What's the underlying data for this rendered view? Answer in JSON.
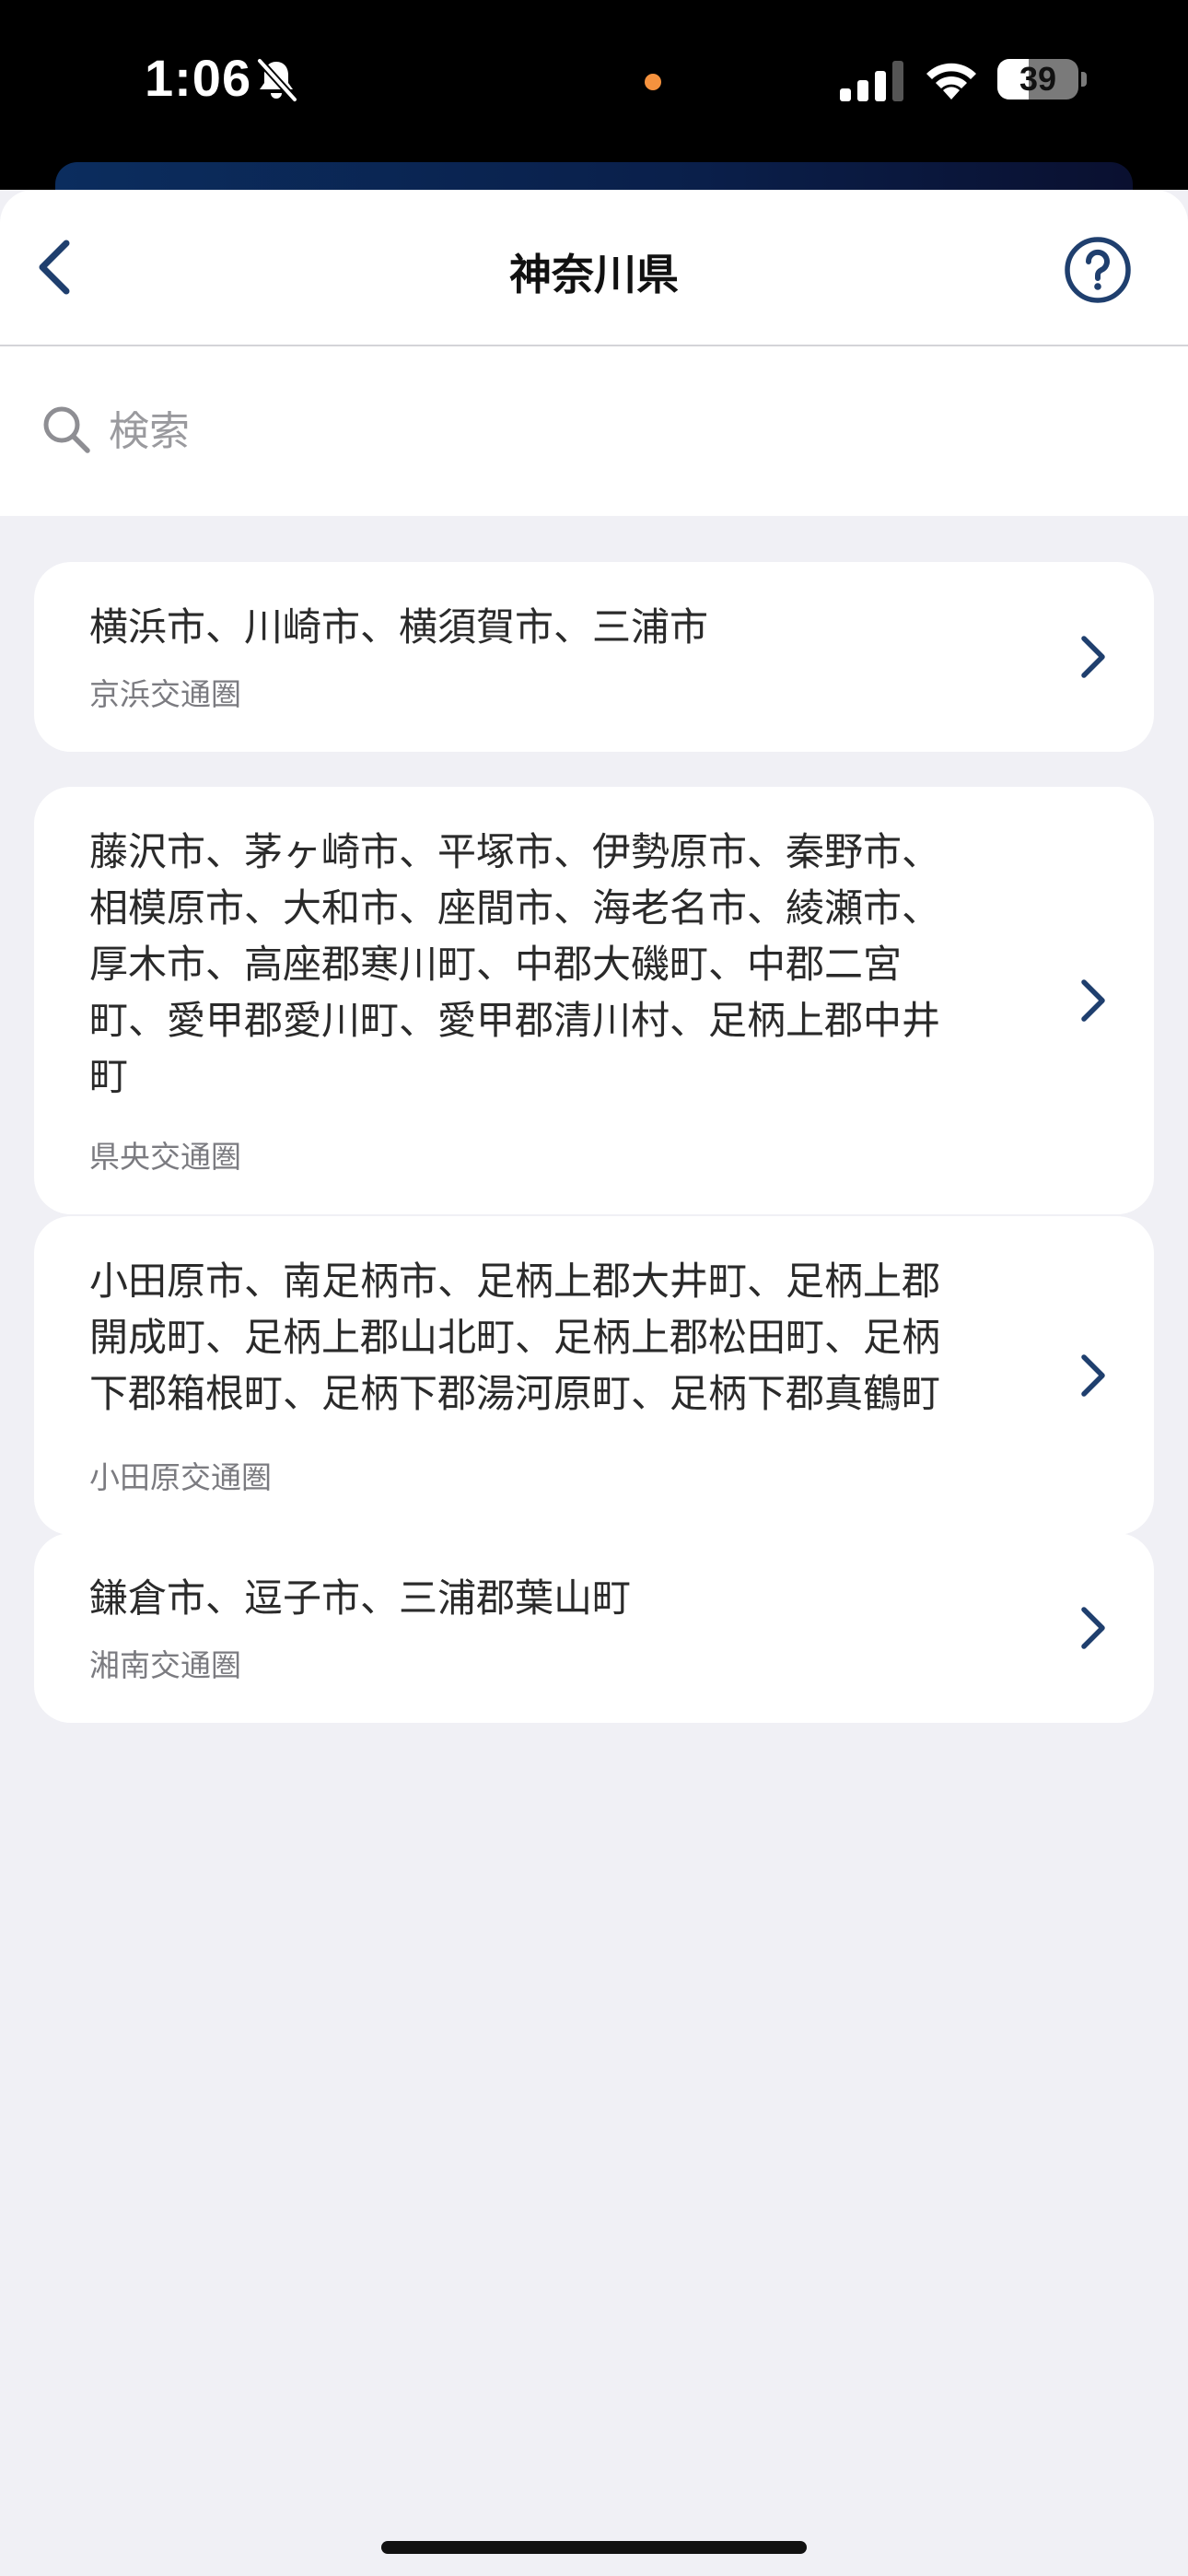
{
  "status_bar": {
    "time": "1:06",
    "battery_percent": "39",
    "battery_level": 0.39
  },
  "header": {
    "title": "神奈川県",
    "back_icon": "chevron-left-icon",
    "help_icon": "question-circle-icon"
  },
  "search": {
    "placeholder": "検索",
    "value": "",
    "icon": "search-icon"
  },
  "regions": [
    {
      "title": "横浜市、川崎市、横須賀市、三浦市",
      "subtitle": "京浜交通圏"
    },
    {
      "title": "藤沢市、茅ヶ崎市、平塚市、伊勢原市、秦野市、\n相模原市、大和市、座間市、海老名市、綾瀬市、\n厚木市、高座郡寒川町、中郡大磯町、中郡二宮\n町、愛甲郡愛川町、愛甲郡清川村、足柄上郡中井\n町",
      "subtitle": "県央交通圏"
    },
    {
      "title": "小田原市、南足柄市、足柄上郡大井町、足柄上郡\n開成町、足柄上郡山北町、足柄上郡松田町、足柄\n下郡箱根町、足柄下郡湯河原町、足柄下郡真鶴町",
      "subtitle": "小田原交通圏"
    },
    {
      "title": "鎌倉市、逗子市、三浦郡葉山町",
      "subtitle": "湘南交通圏"
    }
  ],
  "colors": {
    "accent": "#1f3f6e",
    "background": "#f0f0f5",
    "card": "#ffffff",
    "subtitle": "#7b7b80"
  }
}
